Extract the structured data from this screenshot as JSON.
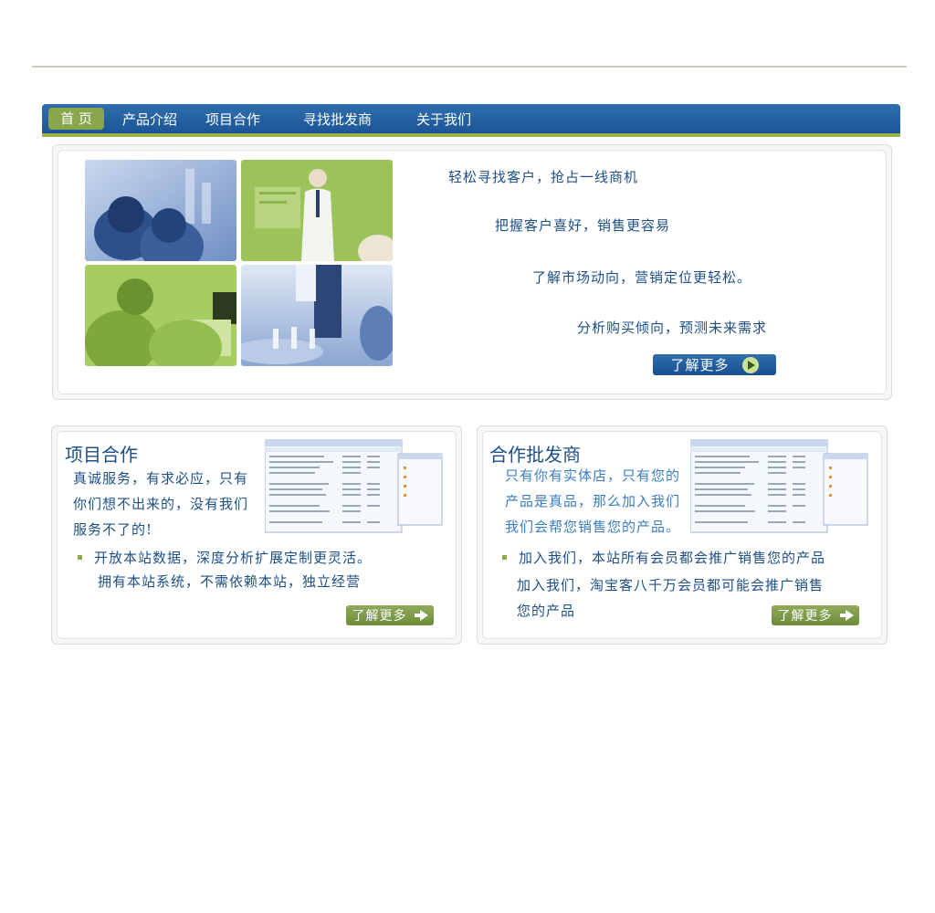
{
  "nav": {
    "items": [
      {
        "label": "首 页",
        "active": true
      },
      {
        "label": "产品介绍"
      },
      {
        "label": "项目合作"
      },
      {
        "label": "寻找批发商"
      },
      {
        "label": "关于我们"
      }
    ]
  },
  "hero": {
    "lines": [
      "轻松寻找客户，抢占一线商机",
      "把握客户喜好，销售更容易",
      "了解市场动向，营销定位更轻松。",
      "分析购买倾向，预测未来需求"
    ],
    "more_label": "了解更多"
  },
  "project": {
    "title": "项目合作",
    "intro": [
      "真诚服务，有求必应，只有",
      "你们想不出来的，没有我们",
      "服务不了的!"
    ],
    "bullet": "开放本站数据，深度分析扩展定制更灵活。",
    "bullet_sub": "拥有本站系统，不需依赖本站，独立经营",
    "more_label": "了解更多"
  },
  "wholesale": {
    "title": "合作批发商",
    "intro": [
      "只有你有实体店，只有您的",
      "产品是真品，那么加入我们",
      "我们会帮您销售您的产品。"
    ],
    "bullet": "加入我们，本站所有会员都会推广销售您的产品",
    "bullet_sub": "加入我们，淘宝客八千万会员都可能会推广销售",
    "bullet_sub2": "您的产品",
    "more_label": "了解更多"
  },
  "colors": {
    "nav_blue": "#1b5596",
    "accent_green": "#8aa64a",
    "text_blue": "#1d4f86"
  }
}
